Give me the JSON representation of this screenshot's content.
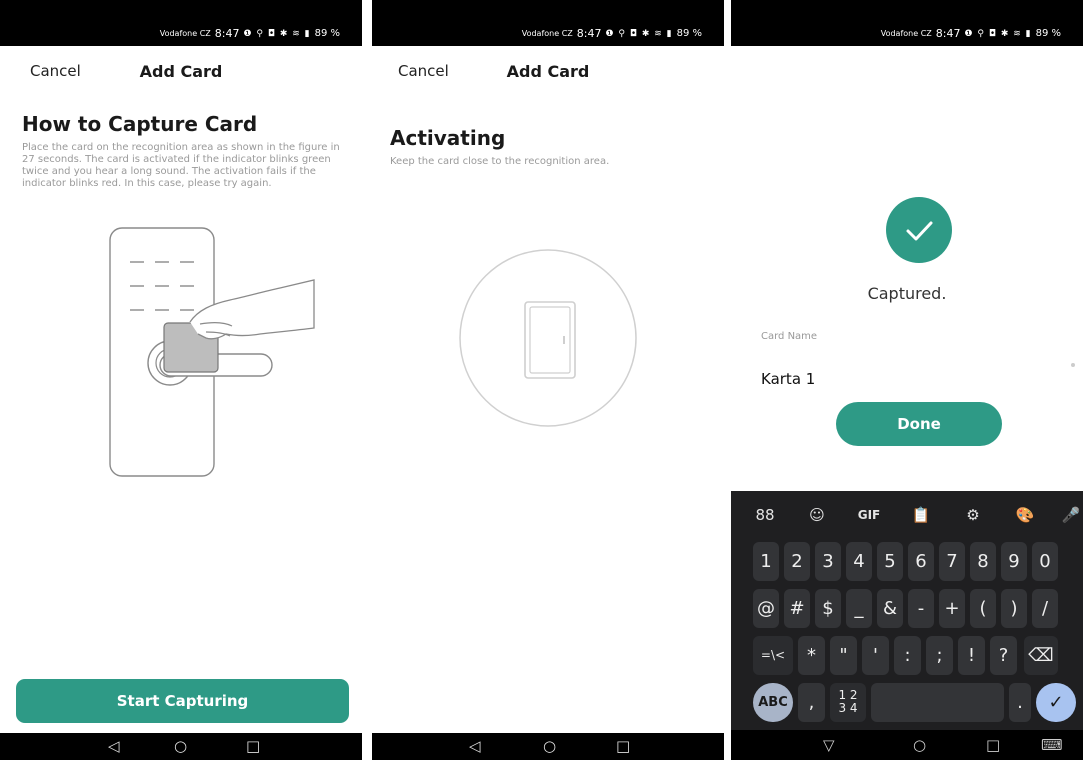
{
  "status": {
    "carrier": "Vodafone CZ",
    "time": "8:47",
    "icons": "❶ ⚲ ◘ ✱ ≋ ▮",
    "battery": "89 %"
  },
  "screen1": {
    "cancel": "Cancel",
    "title": "Add Card",
    "heading": "How to Capture Card",
    "description": "Place the card on the recognition area as shown in the figure in 27 seconds. The card is activated if the indicator blinks green twice and you hear a long sound. The activation fails if the indicator blinks red. In this case, please try again.",
    "button": "Start Capturing"
  },
  "screen2": {
    "cancel": "Cancel",
    "title": "Add Card",
    "heading": "Activating",
    "description": "Keep the card close to the recognition area."
  },
  "screen3": {
    "captured": "Captured.",
    "card_name_label": "Card Name",
    "card_name_value": "Karta 1",
    "done": "Done"
  },
  "navbar": {
    "back": "◁",
    "home": "○",
    "recents": "□"
  },
  "keyboard": {
    "toolbar": [
      "88",
      "☺",
      "GIF",
      "📋",
      "⚙",
      "🎨",
      "🎤"
    ],
    "row1": [
      "1",
      "2",
      "3",
      "4",
      "5",
      "6",
      "7",
      "8",
      "9",
      "0"
    ],
    "row2": [
      "@",
      "#",
      "$",
      "_",
      "&",
      "-",
      "+",
      "(",
      ")",
      "/"
    ],
    "row3": [
      "=\\<",
      "*",
      "\"",
      "'",
      ":",
      ";",
      "!",
      "?",
      "⌫"
    ],
    "row4": [
      "ABC",
      ",",
      "1 2\n3 4",
      "",
      ".",
      "✓"
    ],
    "nav": [
      "▽",
      "○",
      "□",
      "⌨"
    ]
  },
  "colors": {
    "accent": "#2e9a86"
  }
}
